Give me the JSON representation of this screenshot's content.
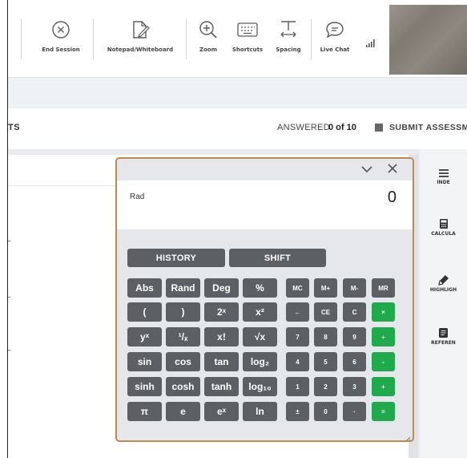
{
  "toolbar": {
    "tools": [
      {
        "id": "end-session",
        "label": "End Session",
        "icon": "close-circle-icon"
      },
      {
        "id": "notepad",
        "label": "Notepad/Whiteboard",
        "icon": "notepad-pencil-icon"
      },
      {
        "id": "zoom",
        "label": "Zoom",
        "icon": "zoom-in-icon"
      },
      {
        "id": "shortcuts",
        "label": "Shortcuts",
        "icon": "keyboard-icon"
      },
      {
        "id": "spacing",
        "label": "Spacing",
        "icon": "text-spacing-icon"
      },
      {
        "id": "live-chat",
        "label": "Live Chat",
        "icon": "chat-bubble-icon"
      }
    ],
    "signal_icon": "signal-bars-icon",
    "camera": "webcam-video-feed"
  },
  "status": {
    "left_text": "TS",
    "answered_label": "ANSWERED",
    "answered_count": "0 of 10",
    "submit_label": "SUBMIT ASSESSM"
  },
  "sidebar": {
    "items": [
      {
        "label": "INDE",
        "icon": "hamburger-menu-icon"
      },
      {
        "label": "CALCULA",
        "icon": "calculator-icon"
      },
      {
        "label": "HIGHLIGH",
        "icon": "highlighter-icon"
      },
      {
        "label": "REFEREN",
        "icon": "reference-book-icon"
      }
    ]
  },
  "calculator": {
    "mode": "Rad",
    "display_value": "0",
    "tabs": {
      "history": "HISTORY",
      "shift": "SHIFT"
    },
    "sci_rows": [
      [
        "Abs",
        "Rand",
        "Deg",
        "%"
      ],
      [
        "(",
        ")",
        "2ˣ",
        "x²"
      ],
      [
        "yˣ",
        "¹/ₓ",
        "x!",
        "√x"
      ],
      [
        "sin",
        "cos",
        "tan",
        "log₂"
      ],
      [
        "sinh",
        "cosh",
        "tanh",
        "log₁₀"
      ],
      [
        "π",
        "e",
        "eˣ",
        "ln"
      ]
    ],
    "num_rows": [
      [
        "MC",
        "M+",
        "M-",
        "MR"
      ],
      [
        "←",
        "CE",
        "C",
        "×"
      ],
      [
        "7",
        "8",
        "9",
        "÷"
      ],
      [
        "4",
        "5",
        "6",
        "-"
      ],
      [
        "1",
        "2",
        "3",
        "+"
      ],
      [
        "±",
        "0",
        "·",
        "="
      ]
    ],
    "colors": {
      "key": "#5c5f64",
      "op": "#1faa4b",
      "border": "#c08a4f"
    }
  }
}
